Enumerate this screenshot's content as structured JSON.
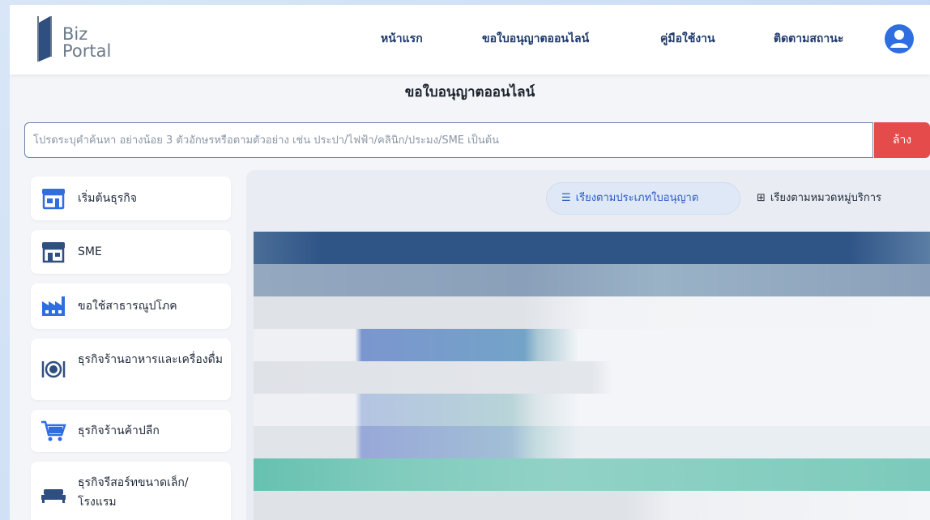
{
  "header": {
    "logo_line1": "Biz",
    "logo_line2": "Portal",
    "nav": [
      {
        "label": "หน้าแรก"
      },
      {
        "label": "ขอใบอนุญาตออนไลน์"
      },
      {
        "label": "คู่มือใช้งาน"
      },
      {
        "label": "ติดตามสถานะ"
      }
    ]
  },
  "page": {
    "title": "ขอใบอนุญาตออนไลน์"
  },
  "search": {
    "placeholder": "โปรดระบุคำค้นหา อย่างน้อย 3 ตัวอักษรหรือตามตัวอย่าง เช่น ประปา/ไฟฟ้า/คลินิก/ประมง/SME เป็นต้น",
    "value": "",
    "clear_label": "ล้าง"
  },
  "sidebar": {
    "items": [
      {
        "label": "เริ่มต้นธุรกิจ",
        "icon": "storefront-icon"
      },
      {
        "label": "SME",
        "icon": "shop-icon"
      },
      {
        "label": "ขอใช้สาธารณูปโภค",
        "icon": "factory-icon"
      },
      {
        "label": "ธุรกิจร้านอาหารและเครื่องดื่ม",
        "icon": "dining-icon"
      },
      {
        "label": "ธุรกิจร้านค้าปลีก",
        "icon": "cart-icon"
      },
      {
        "label": "ธุรกิจรีสอร์ทขนาดเล็ก/โรงแรม",
        "icon": "bed-icon"
      }
    ]
  },
  "view_toggle": {
    "by_type": "เรียงตามประเภทใบอนุญาต",
    "by_category": "เรียงตามหมวดหมู่บริการ"
  },
  "colors": {
    "primary": "#2f6ee1",
    "nav_text": "#1f3a6b",
    "danger": "#e54b4b",
    "table_header": "#2f5587",
    "teal_row": "#77c9b9"
  }
}
